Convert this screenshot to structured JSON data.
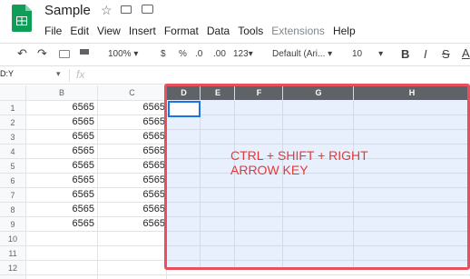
{
  "app": {
    "title": "Sample"
  },
  "menu": {
    "items": [
      "File",
      "Edit",
      "View",
      "Insert",
      "Format",
      "Data",
      "Tools",
      "Extensions",
      "Help"
    ]
  },
  "toolbar": {
    "zoom": "100%",
    "currency": "$",
    "percent": "%",
    "dec_dec": ".0",
    "dec_inc": ".00",
    "more_formats": "123",
    "font": "Default (Ari...",
    "font_size": "10",
    "bold": "B",
    "italic": "I",
    "strike": "S",
    "text_color": "A"
  },
  "formula_bar": {
    "name_box": "D:Y",
    "fx": "fx"
  },
  "columns": [
    "B",
    "C",
    "D",
    "E",
    "F",
    "G",
    "H"
  ],
  "rows": [
    "1",
    "2",
    "3",
    "4",
    "5",
    "6",
    "7",
    "8",
    "9",
    "10",
    "11",
    "12"
  ],
  "col_b": [
    "6565",
    "6565",
    "6565",
    "6565",
    "6565",
    "6565",
    "6565",
    "6565",
    "6565"
  ],
  "col_c": [
    "6565",
    "6565",
    "6565",
    "6565",
    "6565",
    "6565",
    "6565",
    "6565",
    "6565"
  ],
  "annotation": {
    "line1": "CTRL + SHIFT + RIGHT",
    "line2": "ARROW KEY"
  },
  "colors": {
    "brand": "#0f9d58",
    "highlight": "#e8505b",
    "selection": "#e8f0fe"
  }
}
